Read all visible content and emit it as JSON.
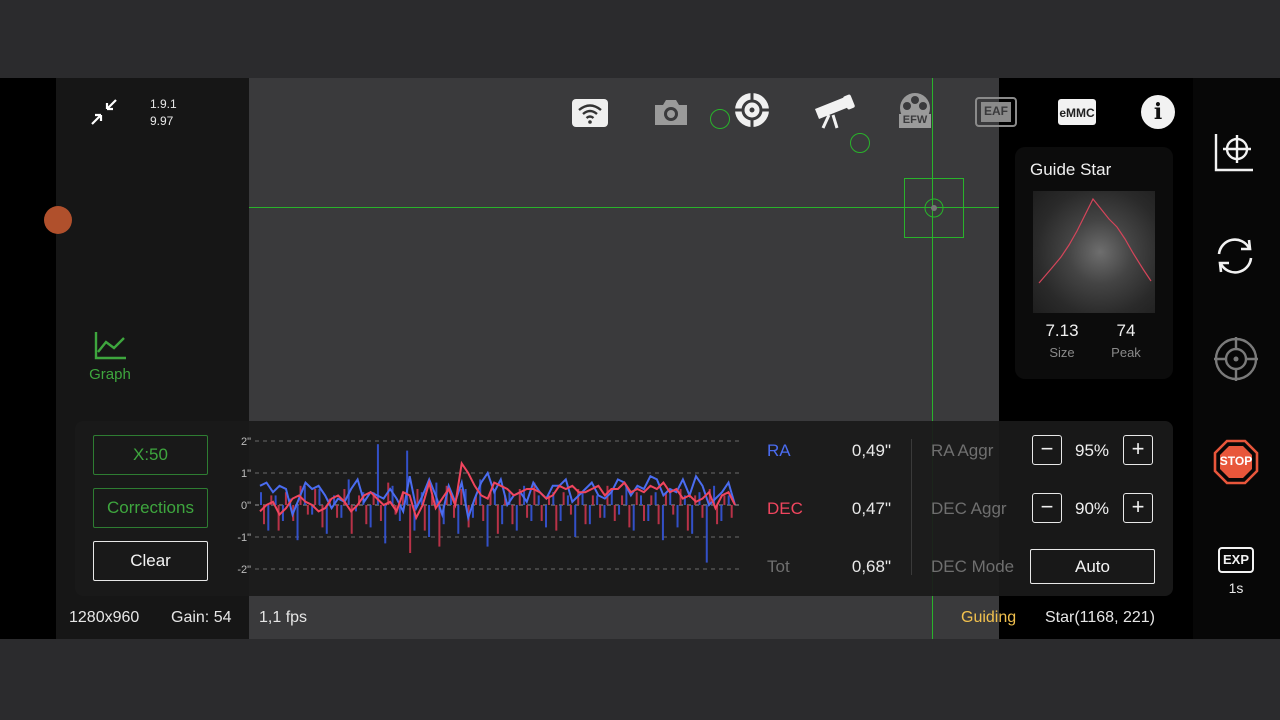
{
  "header": {
    "version_line1": "1.9.1",
    "version_line2": "9.97"
  },
  "toolbar": {
    "icons": [
      "wifi-icon",
      "camera-icon",
      "guide-target-icon",
      "telescope-icon",
      "efw-icon",
      "eaf-icon",
      "emmc-icon",
      "info-icon"
    ],
    "efw_label": "EFW",
    "eaf_label": "EAF",
    "emmc_label": "eMMC",
    "info_label": "i"
  },
  "left": {
    "graph_label": "Graph"
  },
  "guide_star": {
    "title": "Guide Star",
    "size_value": "7.13",
    "size_label": "Size",
    "peak_value": "74",
    "peak_label": "Peak"
  },
  "guide_panel": {
    "scale_button": "X:50",
    "corrections_button": "Corrections",
    "clear_button": "Clear",
    "ra_label": "RA",
    "ra_value": "0,49\"",
    "dec_label": "DEC",
    "dec_value": "0,47\"",
    "tot_label": "Tot",
    "tot_value": "0,68\"",
    "ra_aggr_label": "RA Aggr",
    "ra_aggr_value": "95%",
    "dec_aggr_label": "DEC Aggr",
    "dec_aggr_value": "90%",
    "dec_mode_label": "DEC Mode",
    "dec_mode_value": "Auto",
    "minus": "−",
    "plus": "+"
  },
  "status_bar": {
    "resolution": "1280x960",
    "gain": "Gain: 54",
    "fps": "1,1 fps",
    "state": "Guiding",
    "star": "Star(1168, 221)"
  },
  "right_bar": {
    "stop_label": "STOP",
    "exp_label": "EXP",
    "exp_value": "1s"
  },
  "colors": {
    "accent_green": "#3ea63e",
    "ra_blue": "#4a6cf0",
    "dec_red": "#f0455e",
    "guiding_yellow": "#f2c14e",
    "stop_red": "#e8563b"
  },
  "chart_data": {
    "type": "line",
    "ylabel": "",
    "ylim": [
      -2,
      2
    ],
    "yticks": [
      "2\"",
      "1\"",
      "0\"",
      "-1\"",
      "-2\""
    ],
    "series": [
      {
        "name": "RA",
        "values": [
          0.6,
          0.7,
          0.4,
          0.6,
          0.5,
          -0.3,
          0.2,
          0.7,
          0.5,
          0.6,
          0.3,
          -0.1,
          0.2,
          0.1,
          0.5,
          0.8,
          0.1,
          0.4,
          0.3,
          0.2,
          0.5,
          0.2,
          -0.2,
          0.9,
          -0.1,
          0.3,
          0.8,
          0.3,
          -0.3,
          0.6,
          0.1,
          0.7,
          -0.4,
          0.2,
          0.7,
          1.0,
          0.4,
          0.8,
          0.0,
          0.3,
          0.4,
          0.1,
          0.7,
          0.4,
          0.2,
          0.6,
          0.6,
          0.8,
          0.1,
          0.3,
          0.5,
          0.7,
          0.3,
          0.2,
          0.4,
          0.8,
          0.7,
          0.3,
          0.6,
          0.5,
          0.9,
          0.8,
          0.3,
          0.5,
          0.4,
          0.8,
          0.3,
          0.9,
          0.6,
          0.0,
          0.2,
          0.4,
          0.7,
          0.0
        ]
      },
      {
        "name": "DEC",
        "values": [
          -0.2,
          0.0,
          0.1,
          -0.3,
          -0.1,
          0.2,
          0.3,
          0.1,
          0.0,
          -0.2,
          -0.1,
          0.2,
          0.3,
          0.1,
          -0.2,
          0.0,
          0.3,
          0.4,
          0.2,
          0.0,
          0.1,
          -0.2,
          0.4,
          0.3,
          -0.4,
          0.0,
          0.7,
          -0.1,
          0.2,
          0.5,
          0.0,
          1.3,
          1.0,
          0.6,
          0.3,
          0.2,
          0.7,
          0.6,
          0.5,
          0.3,
          0.4,
          0.5,
          0.5,
          0.4,
          0.2,
          0.3,
          0.6,
          0.5,
          0.6,
          0.4,
          0.4,
          0.5,
          0.6,
          0.3,
          0.5,
          0.5,
          0.7,
          0.4,
          0.5,
          0.4,
          0.6,
          0.5,
          0.7,
          0.4,
          0.5,
          0.2,
          0.3,
          0.1,
          0.2,
          0.4,
          -0.1,
          0.3,
          0.4,
          0.0
        ]
      }
    ],
    "correction_bars": {
      "ra": [
        0.4,
        -0.8,
        0.3,
        -0.5,
        0.2,
        -1.1,
        0.6,
        -0.3,
        0.5,
        -0.9,
        0.3,
        -0.4,
        0.8,
        -0.2,
        0.4,
        -0.7,
        1.9,
        -1.2,
        0.6,
        -0.5,
        1.7,
        -0.8,
        0.4,
        -1.0,
        0.7,
        -0.6,
        0.3,
        -0.9,
        0.5,
        -0.4,
        0.8,
        -1.3,
        0.5,
        -0.6,
        0.4,
        -0.8,
        0.6,
        -0.5,
        0.3,
        -0.7,
        0.4,
        -0.5,
        0.3,
        -1.0,
        0.4,
        -0.6,
        0.3,
        -0.4,
        0.5,
        -0.3,
        0.6,
        -0.8,
        0.3,
        -0.5,
        0.4,
        -1.1,
        0.5,
        -0.7,
        0.3,
        -0.9,
        0.4,
        -1.8,
        0.6,
        -0.5,
        0.3
      ],
      "dec": [
        -0.6,
        0.3,
        -0.8,
        0.4,
        -0.5,
        0.6,
        -0.3,
        0.5,
        -0.7,
        0.2,
        -0.4,
        0.5,
        -0.9,
        0.3,
        -0.6,
        0.4,
        -0.5,
        0.7,
        -0.3,
        0.4,
        -1.5,
        0.5,
        -0.8,
        0.3,
        -1.3,
        0.6,
        -0.4,
        0.5,
        -0.7,
        0.3,
        -0.5,
        0.4,
        -0.9,
        0.3,
        -0.6,
        0.5,
        -0.4,
        0.7,
        -0.5,
        0.3,
        -0.8,
        0.4,
        -0.3,
        0.5,
        -0.6,
        0.3,
        -0.4,
        0.6,
        -0.5,
        0.3,
        -0.7,
        0.4,
        -0.5,
        0.3,
        -0.6,
        0.4,
        -0.3,
        0.5,
        -0.8,
        0.3,
        -0.4,
        0.5,
        -0.6,
        0.3,
        -0.4
      ]
    }
  }
}
